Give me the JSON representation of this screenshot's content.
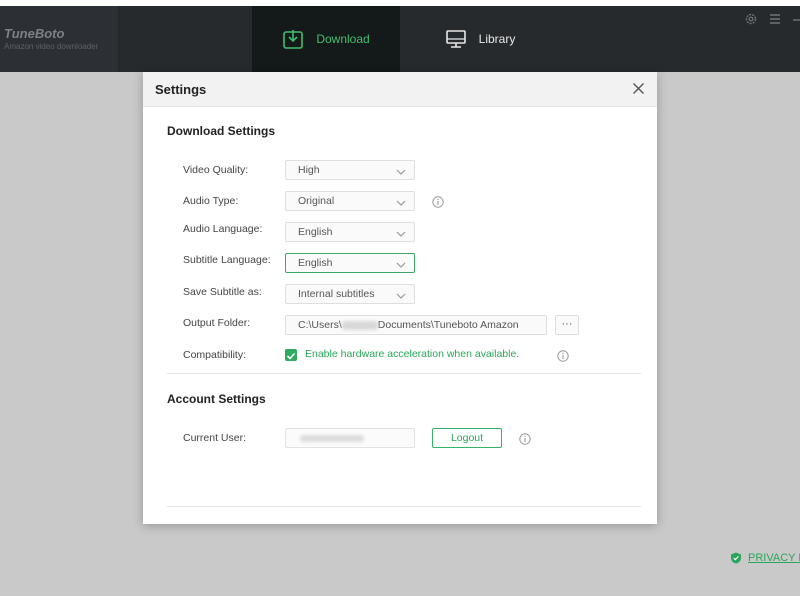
{
  "app": {
    "name": "TuneBoto",
    "subtitle": "Amazon video downloader",
    "accent_color": "#3fbf6e"
  },
  "nav": {
    "tabs": [
      {
        "label": "Download",
        "icon": "download-icon",
        "active": true
      },
      {
        "label": "Library",
        "icon": "monitor-icon",
        "active": false
      }
    ]
  },
  "top_icons": [
    "settings-gear-icon",
    "menu-icon",
    "minimize-icon"
  ],
  "dialog": {
    "title": "Settings",
    "download_section": {
      "title": "Download Settings",
      "video_quality": {
        "label": "Video Quality:",
        "value": "High"
      },
      "audio_type": {
        "label": "Audio Type:",
        "value": "Original"
      },
      "audio_language": {
        "label": "Audio Language:",
        "value": "English"
      },
      "subtitle_language": {
        "label": "Subtitle Language:",
        "value": "English"
      },
      "save_subtitle": {
        "label": "Save Subtitle as:",
        "value": "Internal subtitles"
      },
      "output_folder": {
        "label": "Output Folder:",
        "path_prefix": "C:\\Users\\",
        "path_suffix": "Documents\\Tuneboto Amazon",
        "more_label": "···"
      },
      "compatibility": {
        "label": "Compatibility:",
        "checkbox_label": "Enable hardware acceleration when available.",
        "checked": true
      }
    },
    "account_section": {
      "title": "Account Settings",
      "current_user": {
        "label": "Current User:"
      },
      "logout_label": "Logout"
    }
  },
  "privacy": {
    "label": "PRIVACY P"
  }
}
